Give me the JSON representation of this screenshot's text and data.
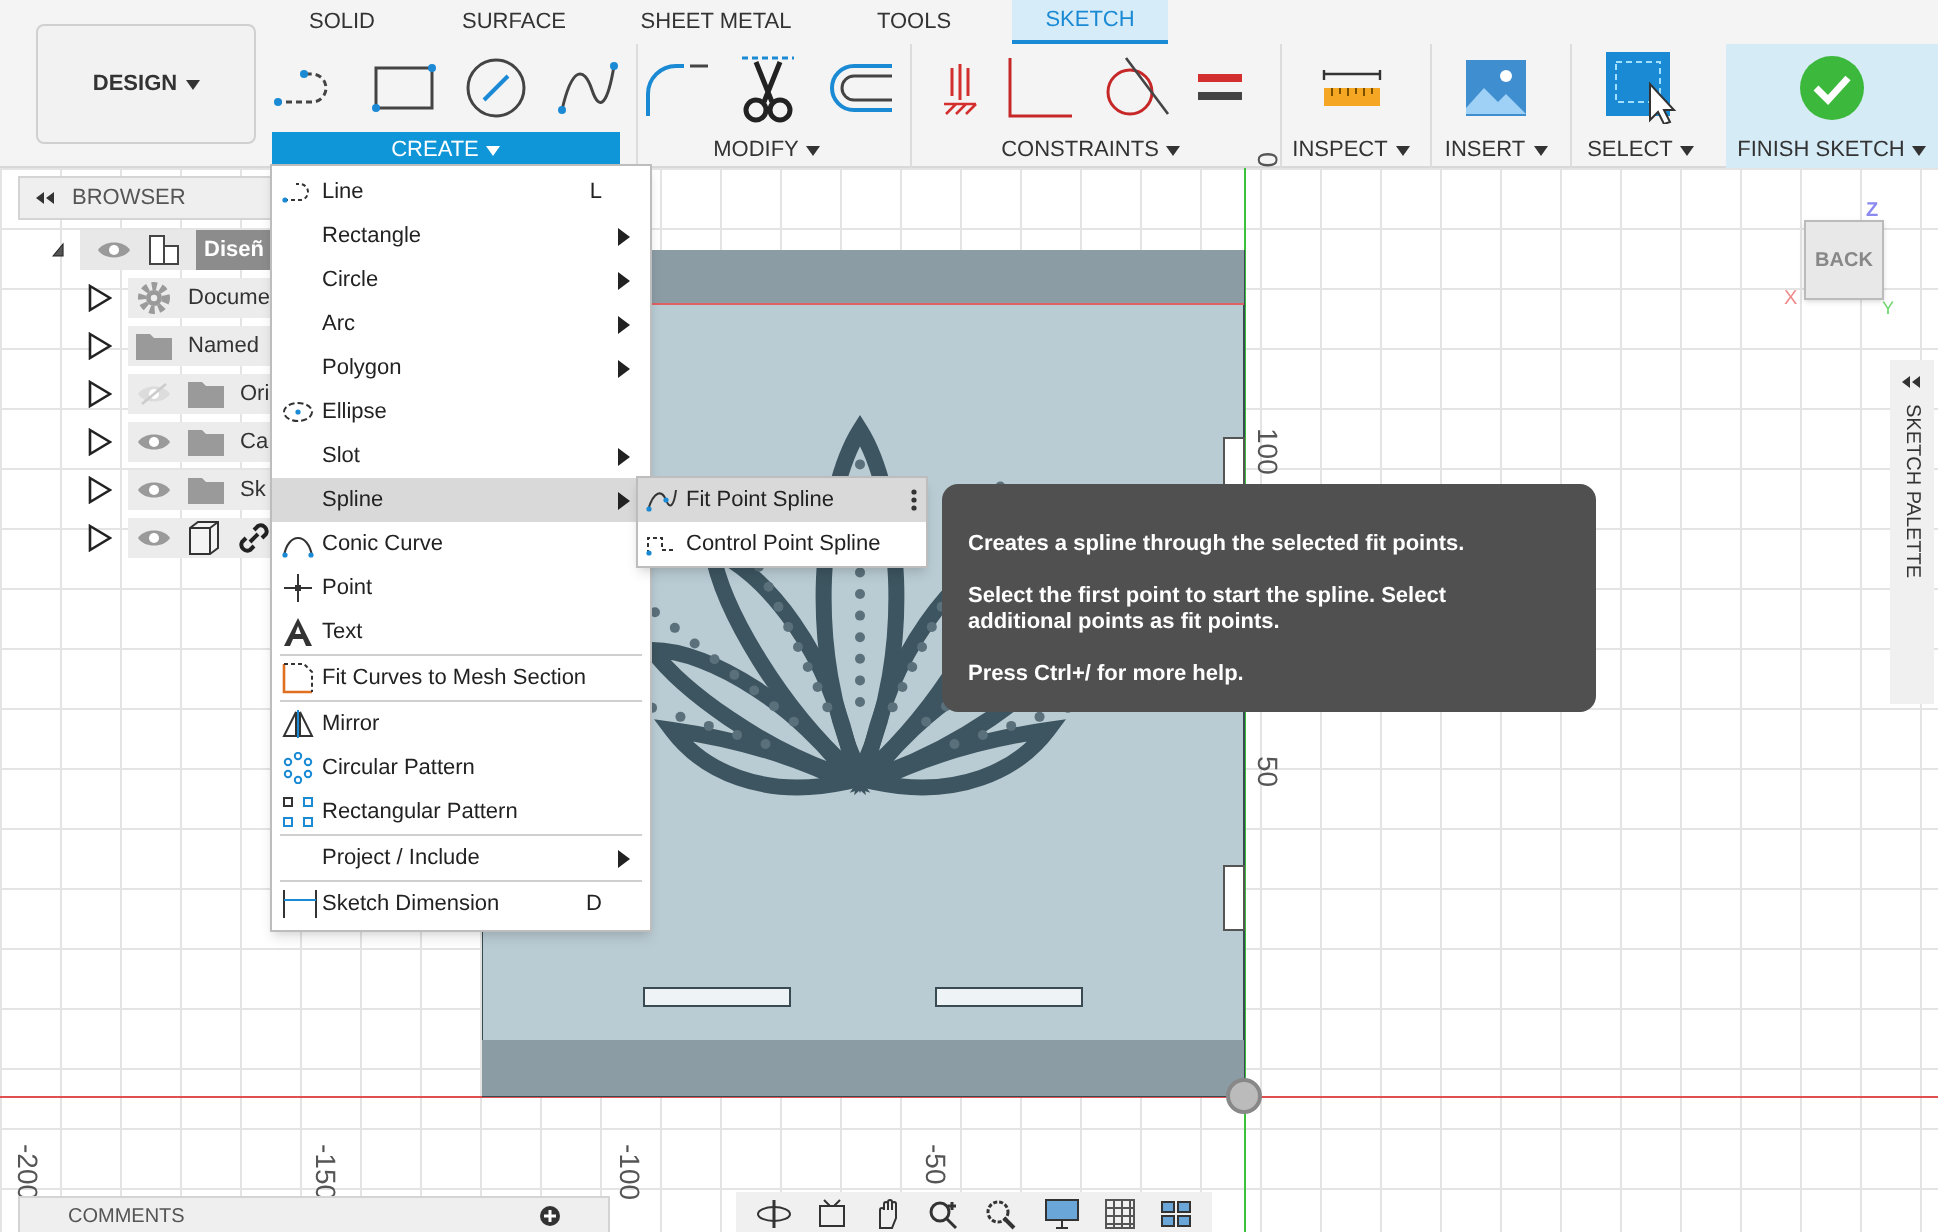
{
  "workspace": {
    "label": "DESIGN"
  },
  "tabs": [
    {
      "label": "SOLID",
      "selected": false
    },
    {
      "label": "SURFACE",
      "selected": false
    },
    {
      "label": "SHEET METAL",
      "selected": false
    },
    {
      "label": "TOOLS",
      "selected": false
    },
    {
      "label": "SKETCH",
      "selected": true
    }
  ],
  "groups": [
    {
      "label": "CREATE",
      "active": true,
      "highlighted": false
    },
    {
      "label": "MODIFY",
      "active": false,
      "highlighted": false
    },
    {
      "label": "CONSTRAINTS",
      "active": false,
      "highlighted": false
    },
    {
      "label": "INSPECT",
      "active": false,
      "highlighted": false
    },
    {
      "label": "INSERT",
      "active": false,
      "highlighted": false
    },
    {
      "label": "SELECT",
      "active": false,
      "highlighted": false
    },
    {
      "label": "FINISH SKETCH",
      "active": false,
      "highlighted": true
    }
  ],
  "browser": {
    "title": "BROWSER",
    "items": [
      {
        "label": "Diseñ",
        "visible": true,
        "expanded": true,
        "children": [
          {
            "label": "Docume",
            "expanded": false
          },
          {
            "label": "Named",
            "expanded": false
          },
          {
            "label": "Ori",
            "visible": false,
            "expanded": false
          },
          {
            "label": "Ca",
            "visible": true,
            "expanded": false
          },
          {
            "label": "Sk",
            "visible": true,
            "expanded": false
          },
          {
            "visible": true,
            "expanded": false
          }
        ]
      }
    ]
  },
  "rulers": {
    "horizontal": [
      "-200",
      "-150",
      "-100",
      "-50"
    ],
    "vertical": [
      "0",
      "100",
      "50"
    ]
  },
  "view_cube": {
    "face": "BACK",
    "z_label": "Z",
    "x_label": "X",
    "y_label": "Y"
  },
  "sketch_palette": {
    "title": "SKETCH PALETTE"
  },
  "create_menu": {
    "sections": [
      [
        {
          "label": "Line",
          "shortcut": "L",
          "submenu": false,
          "selected": false
        },
        {
          "label": "Rectangle",
          "submenu": true,
          "selected": false
        },
        {
          "label": "Circle",
          "submenu": true,
          "selected": false
        },
        {
          "label": "Arc",
          "submenu": true,
          "selected": false
        },
        {
          "label": "Polygon",
          "submenu": true,
          "selected": false
        },
        {
          "label": "Ellipse",
          "submenu": false,
          "selected": false
        },
        {
          "label": "Slot",
          "submenu": true,
          "selected": false
        },
        {
          "label": "Spline",
          "submenu": true,
          "selected": true
        },
        {
          "label": "Conic Curve",
          "submenu": false,
          "selected": false
        },
        {
          "label": "Point",
          "submenu": false,
          "selected": false
        },
        {
          "label": "Text",
          "submenu": false,
          "selected": false
        }
      ],
      [
        {
          "label": "Fit Curves to Mesh Section",
          "submenu": false,
          "selected": false
        }
      ],
      [
        {
          "label": "Mirror",
          "submenu": false,
          "selected": false
        },
        {
          "label": "Circular Pattern",
          "submenu": false,
          "selected": false
        },
        {
          "label": "Rectangular Pattern",
          "submenu": false,
          "selected": false
        }
      ],
      [
        {
          "label": "Project / Include",
          "submenu": true,
          "selected": false
        }
      ],
      [
        {
          "label": "Sketch Dimension",
          "shortcut": "D",
          "submenu": false,
          "selected": false
        }
      ]
    ]
  },
  "spline_submenu": {
    "items": [
      {
        "label": "Fit Point Spline",
        "selected": true
      },
      {
        "label": "Control Point Spline",
        "selected": false
      }
    ]
  },
  "tooltip": {
    "paragraphs": [
      "Creates a spline through the selected fit points.",
      "Select the first point to start the spline. Select additional points as fit points.",
      "Press Ctrl+/ for more help."
    ]
  },
  "comments": {
    "title": "COMMENTS"
  }
}
